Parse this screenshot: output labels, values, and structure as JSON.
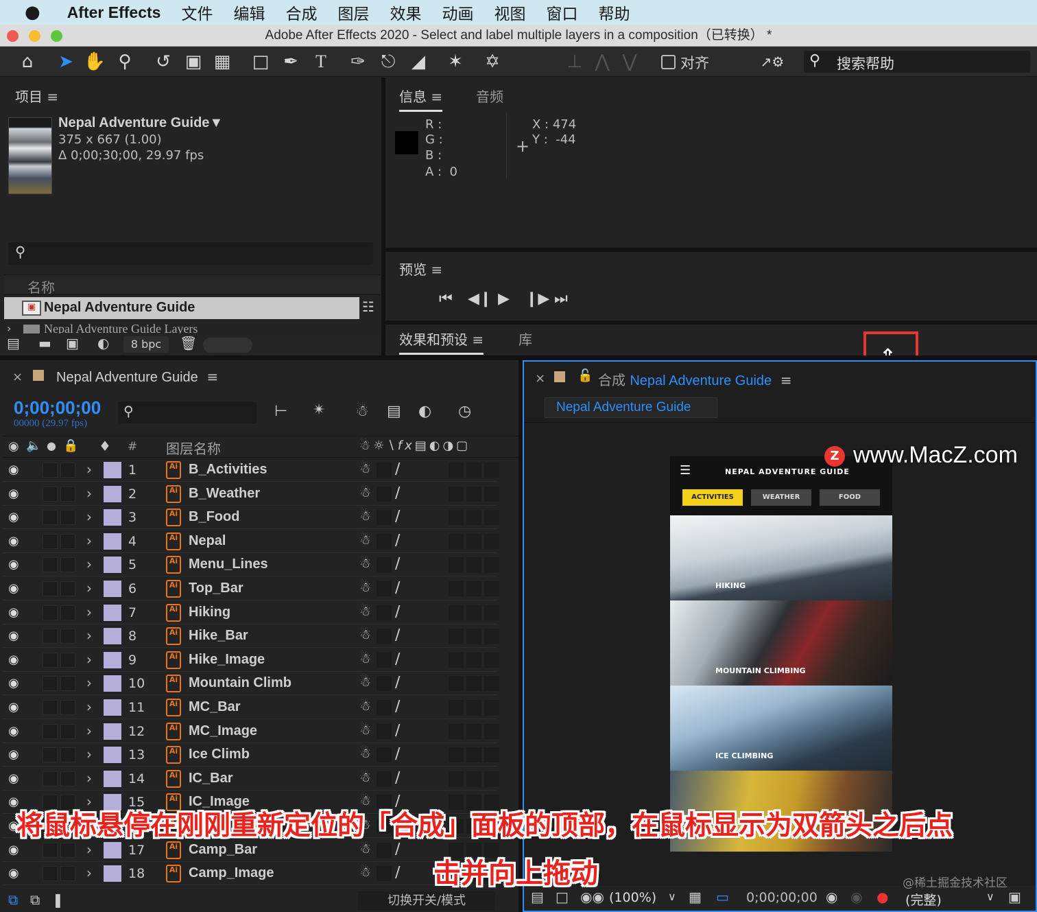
{
  "menubar": {
    "apple": "",
    "items": [
      "After Effects",
      "文件",
      "编辑",
      "合成",
      "图层",
      "效果",
      "动画",
      "视图",
      "窗口",
      "帮助"
    ]
  },
  "window": {
    "title": "Adobe After Effects 2020 - Select and label multiple layers in a composition（已转换） *"
  },
  "toolbar": {
    "align_label": "对齐",
    "search_help": "搜索帮助"
  },
  "project": {
    "tab": "项目",
    "comp_name": "Nepal Adventure Guide▼",
    "comp_size": "375 x 667 (1.00)",
    "comp_duration": "Δ 0;00;30;00, 29.97 fps",
    "name_header": "名称",
    "items": [
      "Nepal Adventure Guide",
      "Nepal Adventure Guide Layers"
    ],
    "bpc": "8 bpc"
  },
  "info": {
    "tab_info": "信息",
    "tab_audio": "音频",
    "r": "R :",
    "g": "G :",
    "b": "B :",
    "a": "A :  0",
    "x": "X : 474",
    "y": "Y :  -44"
  },
  "preview": {
    "tab": "预览"
  },
  "effects": {
    "tab": "效果和预设",
    "tab_lib": "库"
  },
  "timeline": {
    "comp_tab": "Nepal Adventure Guide",
    "timecode": "0;00;00;00",
    "frame_info": "00000 (29.97 fps)",
    "col_num": "#",
    "col_name": "图层名称",
    "toggle_label": "切换开关/模式",
    "layers": [
      {
        "n": "1",
        "name": "B_Activities"
      },
      {
        "n": "2",
        "name": "B_Weather"
      },
      {
        "n": "3",
        "name": "B_Food"
      },
      {
        "n": "4",
        "name": "Nepal"
      },
      {
        "n": "5",
        "name": "Menu_Lines"
      },
      {
        "n": "6",
        "name": "Top_Bar"
      },
      {
        "n": "7",
        "name": "Hiking"
      },
      {
        "n": "8",
        "name": "Hike_Bar"
      },
      {
        "n": "9",
        "name": "Hike_Image"
      },
      {
        "n": "10",
        "name": "Mountain Climb"
      },
      {
        "n": "11",
        "name": "MC_Bar"
      },
      {
        "n": "12",
        "name": "MC_Image"
      },
      {
        "n": "13",
        "name": "Ice Climb"
      },
      {
        "n": "14",
        "name": "IC_Bar"
      },
      {
        "n": "15",
        "name": "IC_Image"
      },
      {
        "n": "16",
        "name": ""
      },
      {
        "n": "17",
        "name": "Camp_Bar"
      },
      {
        "n": "18",
        "name": "Camp_Image"
      }
    ]
  },
  "composition": {
    "prefix": "合成",
    "name": "Nepal Adventure Guide",
    "breadcrumb": "Nepal Adventure Guide",
    "zoom": "(100%)",
    "timecode": "0;00;00;00",
    "quality": "(完整)"
  },
  "app_preview": {
    "title": "NEPAL ADVENTURE GUIDE",
    "tabs": [
      "ACTIVITIES",
      "WEATHER",
      "FOOD"
    ],
    "sections": [
      "HIKING",
      "MOUNTAIN CLIMBING",
      "ICE CLIMBING"
    ]
  },
  "overlay": {
    "watermark": "www.MacZ.com",
    "credit": "@稀土掘金技术社区",
    "caption_line1": "将鼠标悬停在刚刚重新定位的「合成」面板的顶部，在鼠标显示为双箭头之后点",
    "caption_line2": "击并向上拖动"
  },
  "colors": {
    "accent_blue": "#2f8fff",
    "label_purple": "#b5aedb",
    "ai_orange": "#e8761a",
    "highlight_red": "#e8221d",
    "tab_yellow": "#f4d21c"
  }
}
